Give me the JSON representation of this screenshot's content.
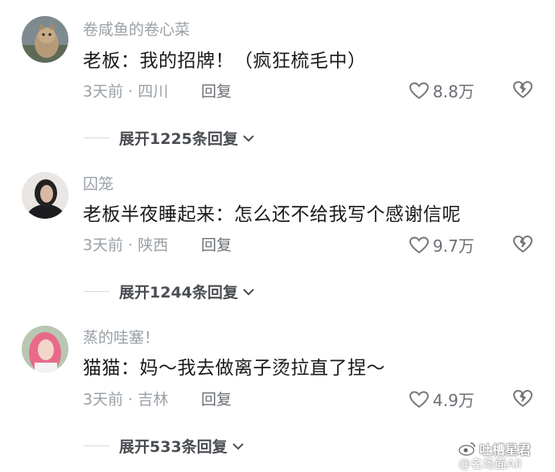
{
  "comments": [
    {
      "username": "卷咸鱼的卷心菜",
      "text": "老板：我的招牌！（疯狂梳毛中）",
      "meta": "3天前 · 四川",
      "reply_label": "回复",
      "likes": "8.8万",
      "expand_label": "展开1225条回复",
      "avatar_icon": "cat-avatar"
    },
    {
      "username": "囚笼",
      "text": "老板半夜睡起来：怎么还不给我写个感谢信呢",
      "meta": "3天前 · 陕西",
      "reply_label": "回复",
      "likes": "9.7万",
      "expand_label": "展开1244条回复",
      "avatar_icon": "girl-avatar"
    },
    {
      "username": "蒸的哇塞！",
      "text": "猫猫：妈～我去做离子烫拉直了捏～",
      "meta": "3天前 · 吉林",
      "reply_label": "回复",
      "likes": "4.9万",
      "expand_label": "展开533条回复",
      "avatar_icon": "pink-hair-avatar"
    }
  ],
  "watermark": {
    "title": "吐槽星君",
    "sub": "@名场面All"
  },
  "colors": {
    "username": "#9aa0a6",
    "text": "#1a1a1a",
    "meta": "#9aa0a6",
    "expand": "#4a4d52"
  }
}
